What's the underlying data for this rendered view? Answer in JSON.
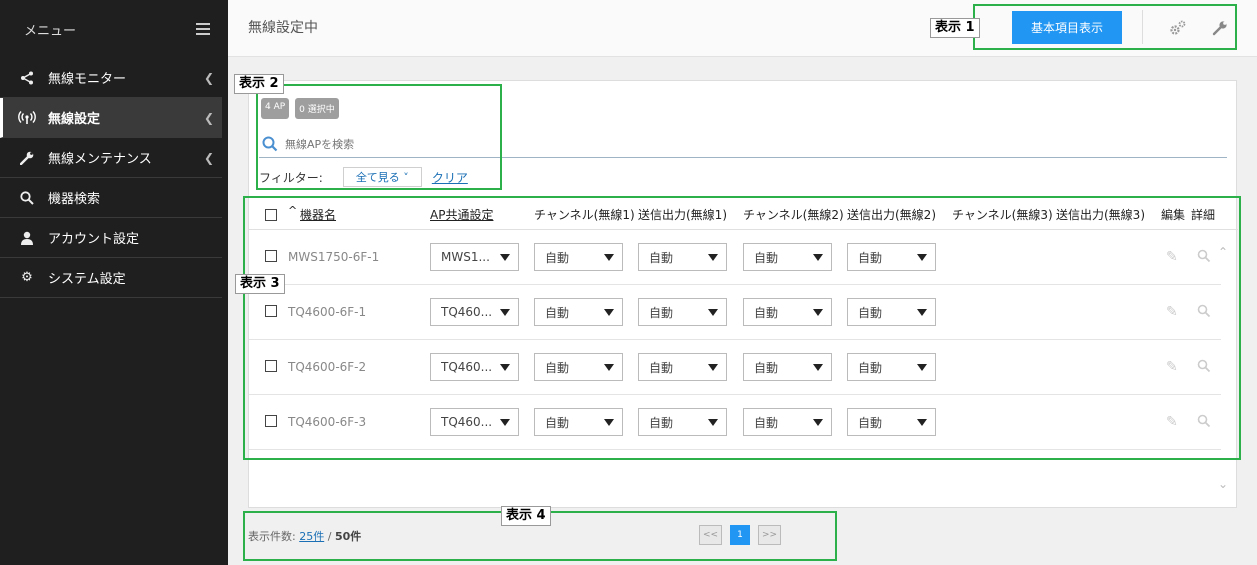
{
  "sidebar": {
    "title": "メニュー",
    "items": [
      {
        "label": "無線モニター",
        "icon": "share-icon"
      },
      {
        "label": "無線設定",
        "icon": "antenna-icon"
      },
      {
        "label": "無線メンテナンス",
        "icon": "wrench-icon"
      },
      {
        "label": "機器検索",
        "icon": "search-icon"
      },
      {
        "label": "アカウント設定",
        "icon": "user-icon"
      },
      {
        "label": "システム設定",
        "icon": "gear-icon"
      }
    ]
  },
  "header": {
    "title": "無線設定中",
    "basic_button": "基本項目表示"
  },
  "filters": {
    "ap_count": "4 AP",
    "selected_count": "0 選択中",
    "search_placeholder": "無線APを検索",
    "filter_label": "フィルター:",
    "filter_value": "全て見る ˅",
    "clear_label": "クリア"
  },
  "table": {
    "sort_marker": "^",
    "headers": {
      "device_name": "機器名",
      "ap_common": "AP共通設定",
      "ch1": "チャンネル(無線1)",
      "tx1": "送信出力(無線1)",
      "ch2": "チャンネル(無線2)",
      "tx2": "送信出力(無線2)",
      "ch3": "チャンネル(無線3)",
      "tx3": "送信出力(無線3)",
      "edit": "編集",
      "detail": "詳細"
    },
    "rows": [
      {
        "name": "MWS1750-6F-1",
        "ap": "MWS1...",
        "ch1": "自動",
        "tx1": "自動",
        "ch2": "自動",
        "tx2": "自動"
      },
      {
        "name": "TQ4600-6F-1",
        "ap": "TQ460...",
        "ch1": "自動",
        "tx1": "自動",
        "ch2": "自動",
        "tx2": "自動"
      },
      {
        "name": "TQ4600-6F-2",
        "ap": "TQ460...",
        "ch1": "自動",
        "tx1": "自動",
        "ch2": "自動",
        "tx2": "自動"
      },
      {
        "name": "TQ4600-6F-3",
        "ap": "TQ460...",
        "ch1": "自動",
        "tx1": "自動",
        "ch2": "自動",
        "tx2": "自動"
      }
    ]
  },
  "footer": {
    "count_label": "表示件数:",
    "per_page": "25件",
    "separator": "/",
    "total": "50件",
    "pager_prev": "<<",
    "pager_current": "1",
    "pager_next": ">>"
  },
  "annotations": {
    "a1": "表示 1",
    "a2": "表示 2",
    "a3": "表示 3",
    "a4": "表示 4"
  },
  "colors": {
    "sidebar_bg": "#1f1f1f",
    "accent": "#2196f3",
    "annotation": "#2cb14a",
    "link": "#1a6fb5"
  }
}
